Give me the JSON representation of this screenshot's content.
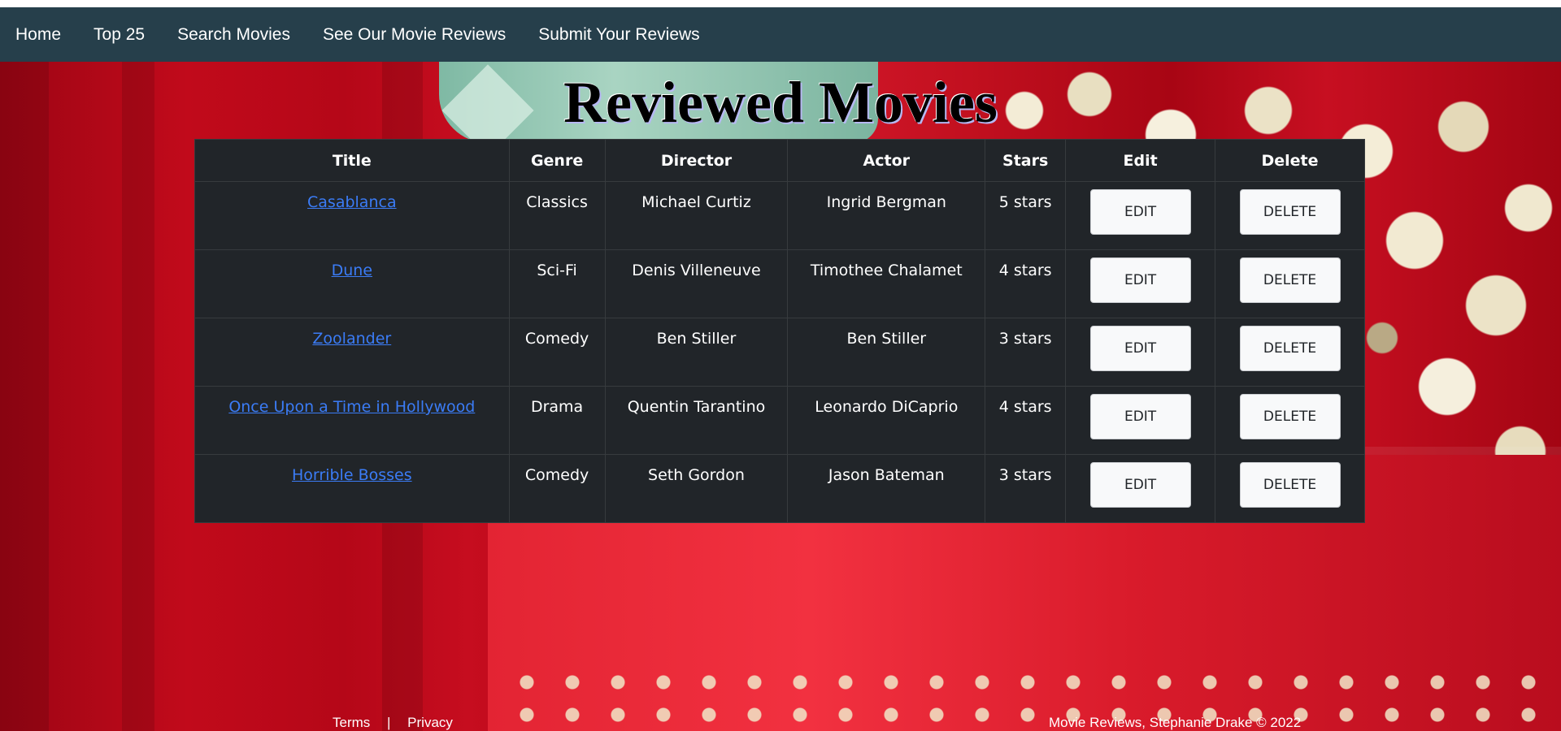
{
  "nav": {
    "items": [
      "Home",
      "Top 25",
      "Search Movies",
      "See Our Movie Reviews",
      "Submit Your Reviews"
    ]
  },
  "page": {
    "title": "Reviewed Movies"
  },
  "table": {
    "headers": [
      "Title",
      "Genre",
      "Director",
      "Actor",
      "Stars",
      "Edit",
      "Delete"
    ],
    "rows": [
      {
        "title": "Casablanca",
        "genre": "Classics",
        "director": "Michael Curtiz",
        "actor": "Ingrid Bergman",
        "stars": "5 stars",
        "edit": "EDIT",
        "delete": "DELETE"
      },
      {
        "title": "Dune",
        "genre": "Sci-Fi",
        "director": "Denis Villeneuve",
        "actor": "Timothee Chalamet",
        "stars": "4 stars",
        "edit": "EDIT",
        "delete": "DELETE"
      },
      {
        "title": "Zoolander",
        "genre": "Comedy",
        "director": "Ben Stiller",
        "actor": "Ben Stiller",
        "stars": "3 stars",
        "edit": "EDIT",
        "delete": "DELETE"
      },
      {
        "title": "Once Upon a Time in Hollywood",
        "genre": "Drama",
        "director": "Quentin Tarantino",
        "actor": "Leonardo DiCaprio",
        "stars": "4 stars",
        "edit": "EDIT",
        "delete": "DELETE"
      },
      {
        "title": "Horrible Bosses",
        "genre": "Comedy",
        "director": "Seth Gordon",
        "actor": "Jason Bateman",
        "stars": "3 stars",
        "edit": "EDIT",
        "delete": "DELETE"
      }
    ]
  },
  "footer": {
    "terms": "Terms",
    "separator": "|",
    "privacy": "Privacy",
    "copyright": "Movie Reviews, Stephanie Drake © 2022"
  },
  "colors": {
    "navbar": "#263f4b",
    "table_bg": "#212529",
    "link": "#3b7cf6",
    "button_bg": "#f8f9fa",
    "background_red": "#c10a1b"
  }
}
